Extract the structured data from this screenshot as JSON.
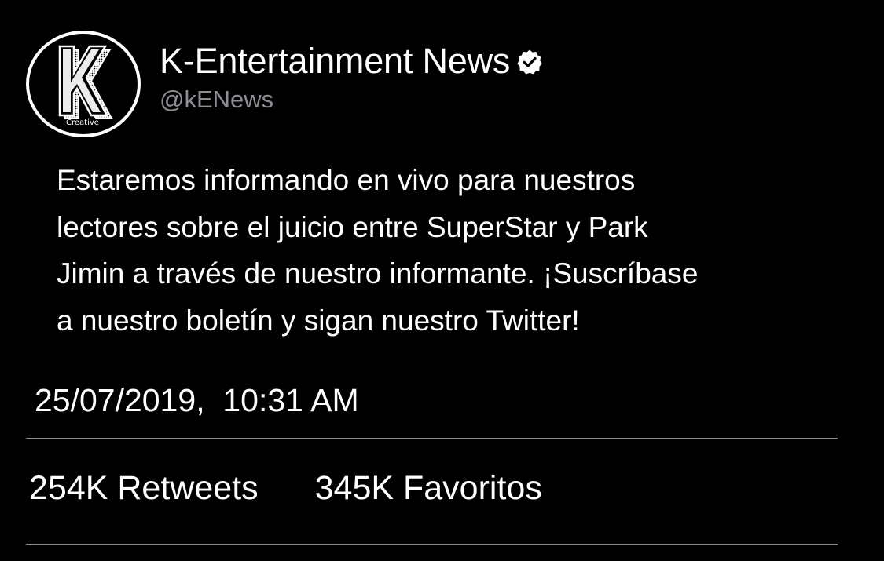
{
  "account": {
    "display_name": "K-Entertainment News",
    "handle": "@kENews",
    "verified": true,
    "avatar_letter": "K",
    "avatar_caption": "Creative"
  },
  "tweet": {
    "text_lines": [
      "Estaremos informando en vivo para nuestros",
      "lectores sobre el juicio entre SuperStar y Park",
      "Jimin a través de nuestro informante. ¡Suscríbase",
      "a nuestro boletín y sigan nuestro Twitter!"
    ],
    "timestamp": "25/07/2019,  10:31 AM"
  },
  "stats": {
    "retweets": "254K Retweets",
    "favorites": "345K Favoritos"
  },
  "colors": {
    "background": "#000000",
    "text": "#ffffff",
    "handle": "#8b8f94",
    "divider": "#8a8a8a"
  },
  "icons": {
    "verified": "verified-badge-icon"
  }
}
